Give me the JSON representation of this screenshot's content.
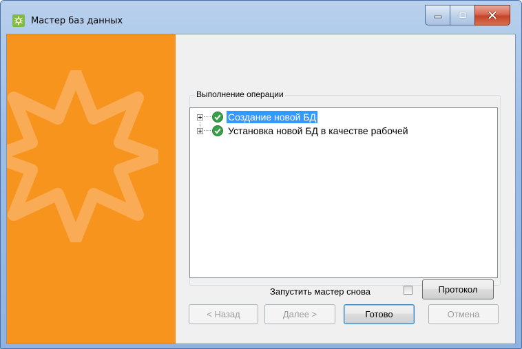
{
  "window": {
    "title": "Мастер баз данных"
  },
  "group": {
    "label": "Выполнение операции",
    "tree": [
      {
        "label": "Создание новой БД",
        "status": "done",
        "selected": true
      },
      {
        "label": "Установка новой БД в качестве рабочей",
        "status": "done",
        "selected": false
      }
    ]
  },
  "options": {
    "restart_label": "Запустить мастер снова",
    "restart_checked": false
  },
  "buttons": {
    "log": "Протокол",
    "back": "< Назад",
    "next": "Далее >",
    "finish": "Готово",
    "cancel": "Отмена"
  },
  "colors": {
    "sidebar": "#f7941d",
    "selection": "#3399ff",
    "success": "#3aa04a"
  }
}
